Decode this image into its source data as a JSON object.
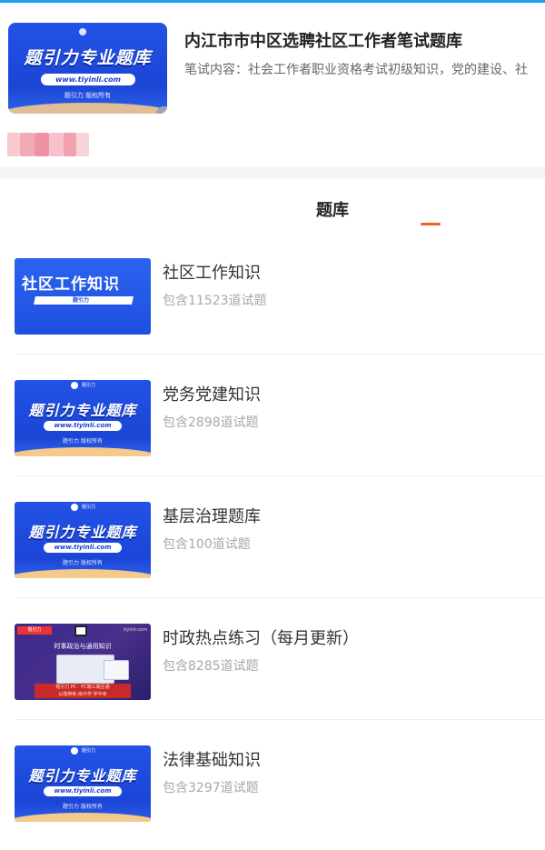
{
  "header": {
    "cover": {
      "brand": "题引力专业题库",
      "url": "www.tiyinli.com",
      "copyright": "题引力 版权所有"
    },
    "title": "内江市市中区选聘社区工作者笔试题库",
    "subtitle": "笔试内容：社会工作者职业资格考试初级知识，党的建设、社"
  },
  "tabs": [
    {
      "label": "题库",
      "active": true
    }
  ],
  "items": [
    {
      "title": "社区工作知识",
      "count": "包含11523道试题",
      "thumb": {
        "variant": "shequ",
        "headline": "社区工作知识",
        "mini": "题引力"
      }
    },
    {
      "title": "党务党建知识",
      "count": "包含2898道试题",
      "thumb": {
        "variant": "brand",
        "logo_text": "题引力",
        "brand": "题引力专业题库",
        "url": "www.tiyinli.com",
        "copyright": "题引力 版权所有"
      }
    },
    {
      "title": "基层治理题库",
      "count": "包含100道试题",
      "thumb": {
        "variant": "brand",
        "logo_text": "题引力",
        "brand": "题引力专业题库",
        "url": "www.tiyinli.com",
        "copyright": "题引力 版权所有"
      }
    },
    {
      "title": "时政热点练习（每月更新）",
      "count": "包含8285道试题",
      "thumb": {
        "variant": "news",
        "tag": "题引力",
        "site": "tiyinli.com",
        "headline": "时事政治与通用知识",
        "box_line1": "题引力 PC · PC端三端互通",
        "box_line2": "以题带练·练中学·学中考"
      }
    },
    {
      "title": "法律基础知识",
      "count": "包含3297道试题",
      "thumb": {
        "variant": "brand",
        "logo_text": "题引力",
        "brand": "题引力专业题库",
        "url": "www.tiyinli.com",
        "copyright": "题引力 版权所有"
      }
    }
  ],
  "colors": {
    "accent": "#f0602a",
    "top_strip": "#1ea0f0",
    "brand_blue": "#1b45d6"
  }
}
